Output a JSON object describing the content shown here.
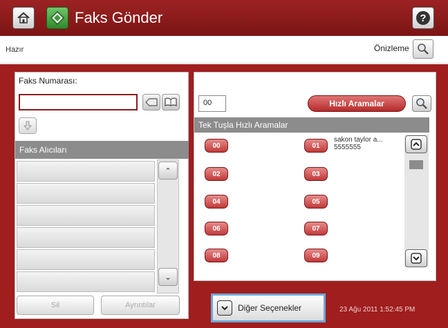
{
  "app": {
    "title": "Faks Gönder"
  },
  "status": {
    "text": "Hazır",
    "preview_label": "Önizleme"
  },
  "fax_number": {
    "label": "Faks Numarası:",
    "value": ""
  },
  "recipients": {
    "header": "Faks Alıcıları",
    "rows": [
      "",
      "",
      "",
      "",
      "",
      ""
    ]
  },
  "footer": {
    "delete_label": "Sil",
    "details_label": "Ayrıntılar"
  },
  "speed_dial": {
    "code_value": "00",
    "button_label": "Hızlı Aramalar",
    "header": "Tek Tuşla Hızlı Aramalar",
    "entries": [
      {
        "code": "00",
        "name": ""
      },
      {
        "code": "01",
        "name": "sakon taylor a...",
        "number": "5555555"
      },
      {
        "code": "02",
        "name": ""
      },
      {
        "code": "03",
        "name": ""
      },
      {
        "code": "04",
        "name": ""
      },
      {
        "code": "05",
        "name": ""
      },
      {
        "code": "06",
        "name": ""
      },
      {
        "code": "07",
        "name": ""
      },
      {
        "code": "08",
        "name": ""
      },
      {
        "code": "09",
        "name": ""
      }
    ]
  },
  "more_options": {
    "label": "Diğer Seçenekler"
  },
  "timestamp": "23 Ağu 2011 1:52:45 PM",
  "colors": {
    "title_bar": "#8a1c1c",
    "accent_red": "#c13a3a",
    "highlight_blue": "#6aa8d8",
    "header_gray": "#8c8c8c"
  },
  "icons": {
    "home": "home-icon",
    "fax": "fax-icon",
    "help": "help-icon",
    "preview": "magnifier-icon",
    "search": "magnifier-icon"
  }
}
